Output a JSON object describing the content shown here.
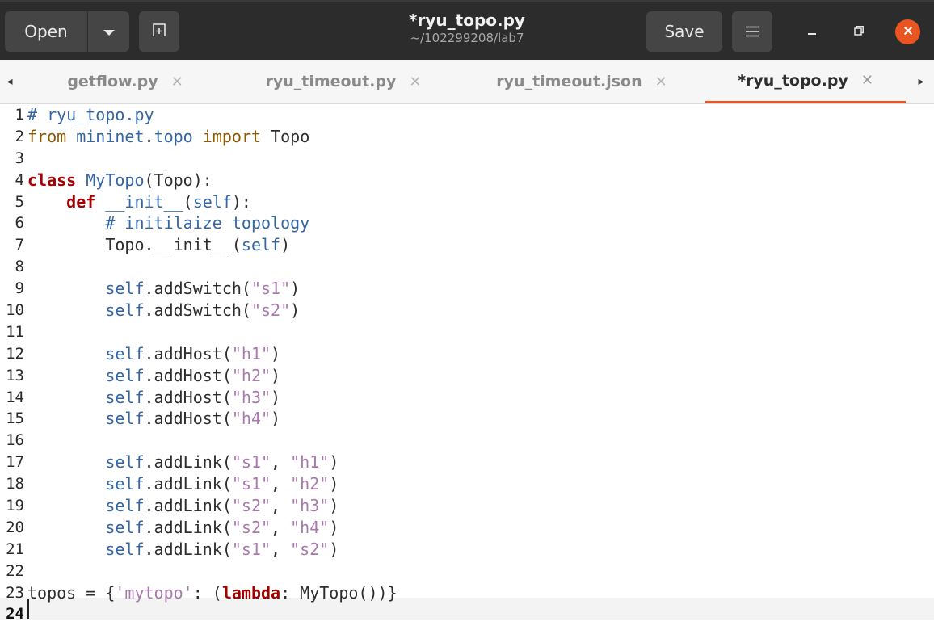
{
  "header": {
    "open_label": "Open",
    "title": "*ryu_topo.py",
    "subtitle": "~/102299208/lab7",
    "save_label": "Save"
  },
  "tabs": [
    {
      "label": "getflow.py",
      "active": false
    },
    {
      "label": "ryu_timeout.py",
      "active": false
    },
    {
      "label": "ryu_timeout.json",
      "active": false
    },
    {
      "label": "*ryu_topo.py",
      "active": true
    }
  ],
  "icons": {
    "dropdown": "chevron-down-icon",
    "new_tab": "new-tab-icon",
    "menu": "hamburger-menu-icon",
    "minimize": "minimize-icon",
    "maximize": "restore-icon",
    "close": "close-icon",
    "tab_close": "x",
    "scroll_left": "◂",
    "scroll_right": "▸"
  },
  "colors": {
    "accent": "#e95420",
    "keyword": "#a40000",
    "string": "#a979ad",
    "comment": "#3465a4"
  },
  "editor": {
    "current_line": 24,
    "line_numbers": [
      "1",
      "2",
      "3",
      "4",
      "5",
      "6",
      "7",
      "8",
      "9",
      "10",
      "11",
      "12",
      "13",
      "14",
      "15",
      "16",
      "17",
      "18",
      "19",
      "20",
      "21",
      "22",
      "23",
      "24"
    ],
    "lines": [
      "# ryu_topo.py",
      "from mininet.topo import Topo",
      "",
      "class MyTopo(Topo):",
      "    def __init__(self):",
      "        # initilaize topology",
      "        Topo.__init__(self)",
      "",
      "        self.addSwitch(\"s1\")",
      "        self.addSwitch(\"s2\")",
      "",
      "        self.addHost(\"h1\")",
      "        self.addHost(\"h2\")",
      "        self.addHost(\"h3\")",
      "        self.addHost(\"h4\")",
      "",
      "        self.addLink(\"s1\", \"h1\")",
      "        self.addLink(\"s1\", \"h2\")",
      "        self.addLink(\"s2\", \"h3\")",
      "        self.addLink(\"s2\", \"h4\")",
      "        self.addLink(\"s1\", \"s2\")",
      "",
      "topos = {'mytopo': (lambda: MyTopo())}",
      ""
    ]
  }
}
